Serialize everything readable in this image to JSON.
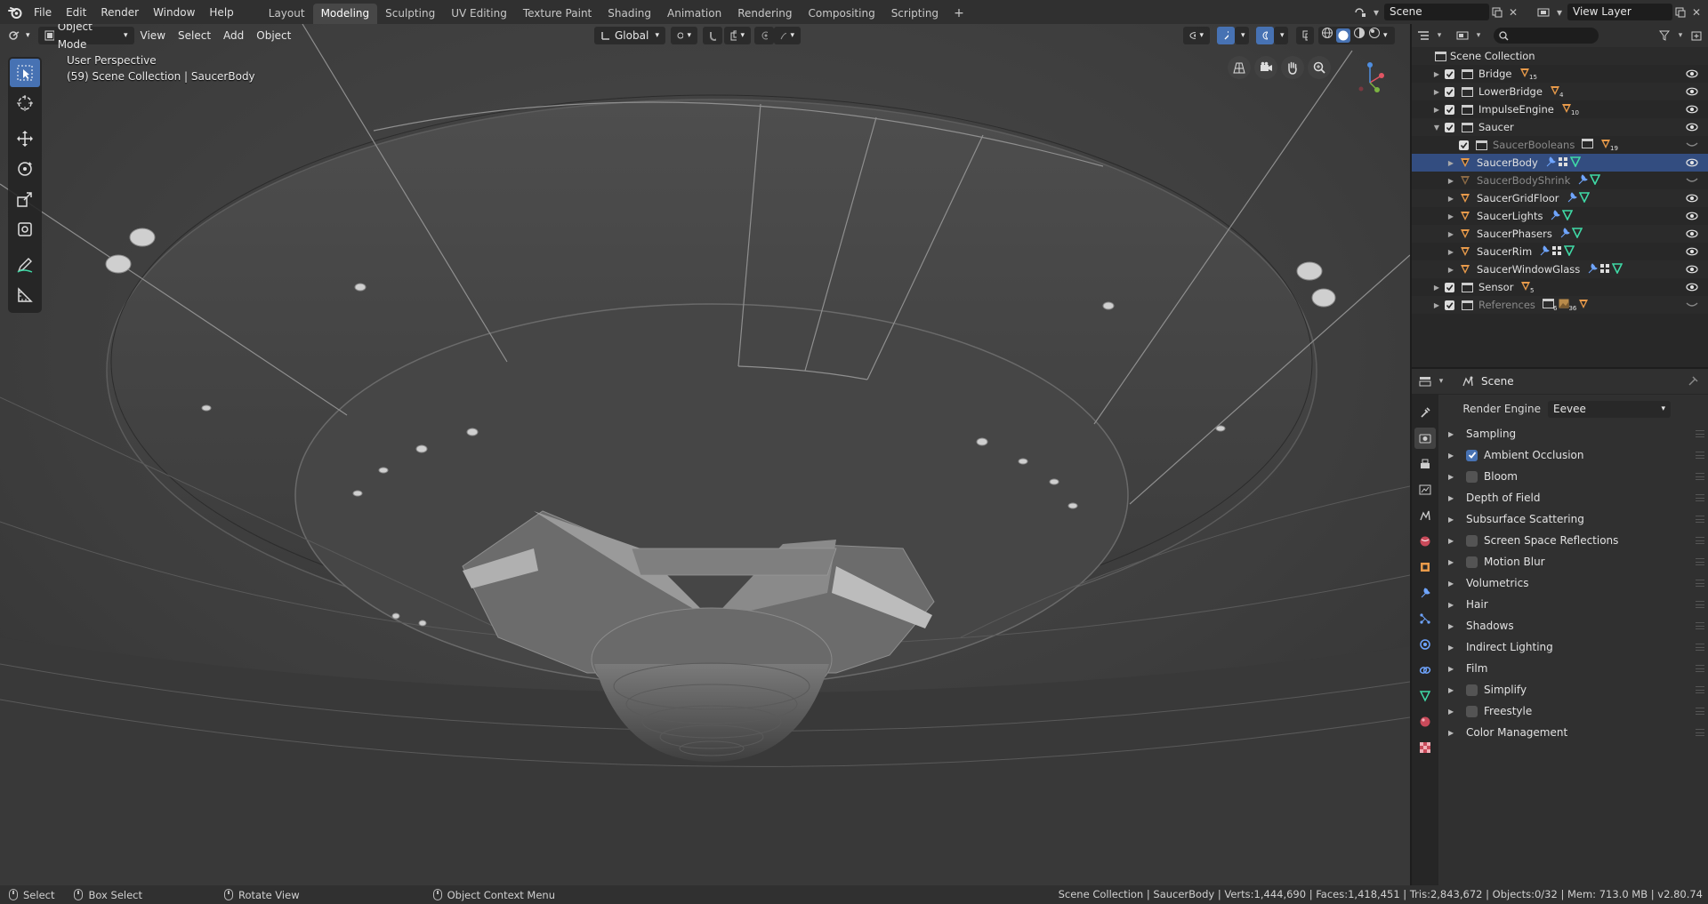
{
  "menu": [
    "File",
    "Edit",
    "Render",
    "Window",
    "Help"
  ],
  "workspaces": [
    "Layout",
    "Modeling",
    "Sculpting",
    "UV Editing",
    "Texture Paint",
    "Shading",
    "Animation",
    "Rendering",
    "Compositing",
    "Scripting"
  ],
  "active_workspace": "Modeling",
  "workspace_add": "+",
  "scene_name": "Scene",
  "view_layer": "View Layer",
  "viewport": {
    "mode": "Object Mode",
    "menus": [
      "View",
      "Select",
      "Add",
      "Object"
    ],
    "orientation": "Global",
    "title": "User Perspective",
    "subtitle": "(59) Scene Collection | SaucerBody"
  },
  "outliner": {
    "root": "Scene Collection",
    "rows": [
      {
        "label": "Bridge",
        "badge": "15"
      },
      {
        "label": "LowerBridge",
        "badge": "4"
      },
      {
        "label": "ImpulseEngine",
        "badge": "10"
      },
      {
        "label": "Saucer",
        "badge": ""
      },
      {
        "label": "SaucerBooleans",
        "badge": "19"
      },
      {
        "label": "SaucerBody",
        "badge": ""
      },
      {
        "label": "SaucerBodyShrink",
        "badge": ""
      },
      {
        "label": "SaucerGridFloor",
        "badge": ""
      },
      {
        "label": "SaucerLights",
        "badge": ""
      },
      {
        "label": "SaucerPhasers",
        "badge": ""
      },
      {
        "label": "SaucerRim",
        "badge": ""
      },
      {
        "label": "SaucerWindowGlass",
        "badge": ""
      },
      {
        "label": "Sensor",
        "badge": "5"
      },
      {
        "label": "References",
        "badge": "6",
        "badge2": "36"
      }
    ]
  },
  "properties": {
    "context": "Scene",
    "render_engine_label": "Render Engine",
    "render_engine": "Eevee",
    "panels": [
      {
        "label": "Sampling"
      },
      {
        "label": "Ambient Occlusion",
        "checked": true
      },
      {
        "label": "Bloom",
        "checked": false
      },
      {
        "label": "Depth of Field"
      },
      {
        "label": "Subsurface Scattering"
      },
      {
        "label": "Screen Space Reflections",
        "checked": false
      },
      {
        "label": "Motion Blur",
        "checked": false
      },
      {
        "label": "Volumetrics"
      },
      {
        "label": "Hair"
      },
      {
        "label": "Shadows"
      },
      {
        "label": "Indirect Lighting"
      },
      {
        "label": "Film"
      },
      {
        "label": "Simplify",
        "checked": false
      },
      {
        "label": "Freestyle",
        "checked": false
      },
      {
        "label": "Color Management"
      }
    ]
  },
  "statusbar": {
    "select": "Select",
    "box_select": "Box Select",
    "rotate": "Rotate View",
    "context_menu": "Object Context Menu",
    "stats": "Scene Collection | SaucerBody | Verts:1,444,690 | Faces:1,418,451 | Tris:2,843,672 | Objects:0/32 | Mem: 713.0 MB | v2.80.74"
  },
  "colors": {
    "accent": "#4772b3",
    "selected_row": "#334d80",
    "object_orange": "#e89a4a",
    "mesh_green": "#3fd9a6",
    "modifier_blue": "#6fa5ff"
  }
}
